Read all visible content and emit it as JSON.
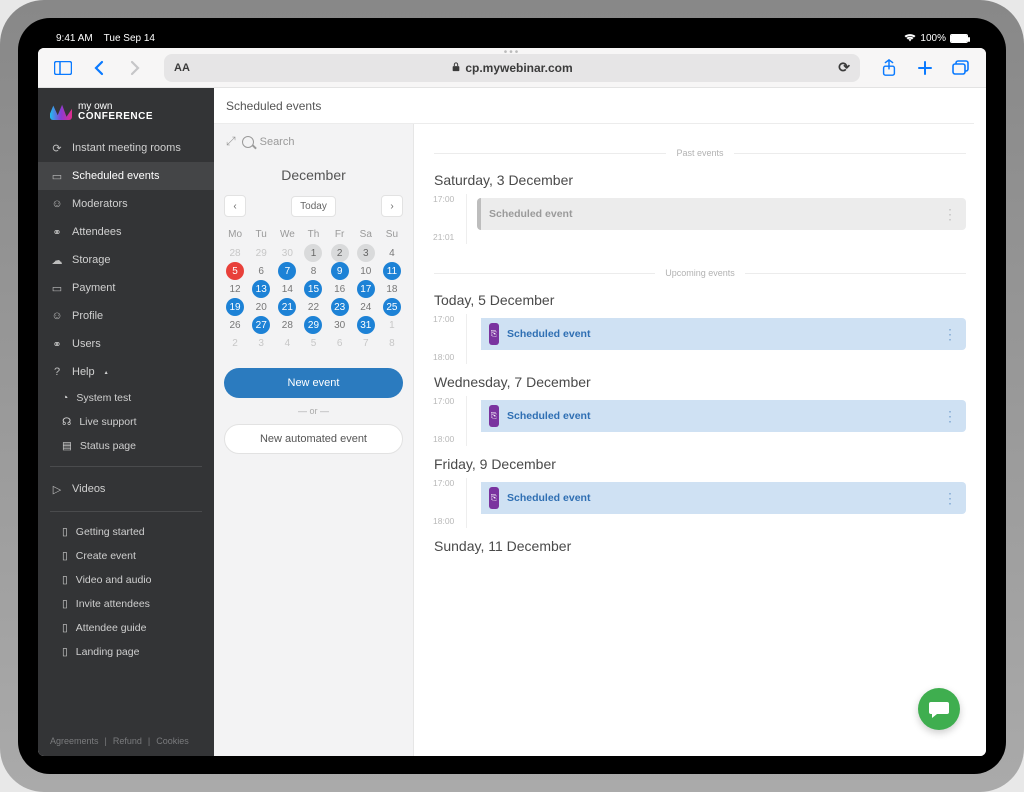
{
  "status": {
    "time": "9:41 AM",
    "date": "Tue Sep 14",
    "battery": "100%"
  },
  "browser": {
    "url": "cp.mywebinar.com",
    "aa": "AA"
  },
  "brand": {
    "line1": "my own",
    "line2": "CONFERENCE"
  },
  "nav": {
    "instant": "Instant meeting rooms",
    "scheduled": "Scheduled events",
    "moderators": "Moderators",
    "attendees": "Attendees",
    "storage": "Storage",
    "payment": "Payment",
    "profile": "Profile",
    "users": "Users",
    "help": "Help",
    "system_test": "System test",
    "live_support": "Live support",
    "status_page": "Status page",
    "videos": "Videos",
    "getting_started": "Getting started",
    "create_event": "Create event",
    "video_audio": "Video and audio",
    "invite_attendees": "Invite attendees",
    "attendee_guide": "Attendee guide",
    "landing_page": "Landing page"
  },
  "footer": {
    "agreements": "Agreements",
    "refund": "Refund",
    "cookies": "Cookies"
  },
  "page_title": "Scheduled events",
  "search_placeholder": "Search",
  "calendar": {
    "month": "December",
    "today_btn": "Today",
    "dow": [
      "Mo",
      "Tu",
      "We",
      "Th",
      "Fr",
      "Sa",
      "Su"
    ],
    "rows": [
      [
        {
          "n": "28",
          "cls": "dim"
        },
        {
          "n": "29",
          "cls": "dim"
        },
        {
          "n": "30",
          "cls": "dim"
        },
        {
          "n": "1",
          "cls": "gray-cell"
        },
        {
          "n": "2",
          "cls": "gray-cell"
        },
        {
          "n": "3",
          "cls": "gray-cell"
        },
        {
          "n": "4",
          "cls": ""
        }
      ],
      [
        {
          "n": "5",
          "cls": "today-cell"
        },
        {
          "n": "6",
          "cls": ""
        },
        {
          "n": "7",
          "cls": "has-event"
        },
        {
          "n": "8",
          "cls": ""
        },
        {
          "n": "9",
          "cls": "has-event"
        },
        {
          "n": "10",
          "cls": ""
        },
        {
          "n": "11",
          "cls": "has-event"
        }
      ],
      [
        {
          "n": "12",
          "cls": ""
        },
        {
          "n": "13",
          "cls": "has-event"
        },
        {
          "n": "14",
          "cls": ""
        },
        {
          "n": "15",
          "cls": "has-event"
        },
        {
          "n": "16",
          "cls": ""
        },
        {
          "n": "17",
          "cls": "has-event"
        },
        {
          "n": "18",
          "cls": ""
        }
      ],
      [
        {
          "n": "19",
          "cls": "has-event"
        },
        {
          "n": "20",
          "cls": ""
        },
        {
          "n": "21",
          "cls": "has-event"
        },
        {
          "n": "22",
          "cls": ""
        },
        {
          "n": "23",
          "cls": "has-event"
        },
        {
          "n": "24",
          "cls": ""
        },
        {
          "n": "25",
          "cls": "has-event"
        }
      ],
      [
        {
          "n": "26",
          "cls": ""
        },
        {
          "n": "27",
          "cls": "has-event"
        },
        {
          "n": "28",
          "cls": ""
        },
        {
          "n": "29",
          "cls": "has-event"
        },
        {
          "n": "30",
          "cls": ""
        },
        {
          "n": "31",
          "cls": "has-event"
        },
        {
          "n": "1",
          "cls": "dim"
        }
      ],
      [
        {
          "n": "2",
          "cls": "dim"
        },
        {
          "n": "3",
          "cls": "dim"
        },
        {
          "n": "4",
          "cls": "dim"
        },
        {
          "n": "5",
          "cls": "dim"
        },
        {
          "n": "6",
          "cls": "dim"
        },
        {
          "n": "7",
          "cls": "dim"
        },
        {
          "n": "8",
          "cls": "dim"
        }
      ]
    ]
  },
  "buttons": {
    "new_event": "New event",
    "or": "— or —",
    "new_auto": "New automated event"
  },
  "dividers": {
    "past": "Past events",
    "upcoming": "Upcoming events"
  },
  "days": [
    {
      "heading": "Saturday, 3 December",
      "t1": "17:00",
      "t2": "21:01",
      "event": "Scheduled event",
      "kind": "past"
    },
    {
      "heading": "Today, 5 December",
      "t1": "17:00",
      "t2": "18:00",
      "event": "Scheduled event",
      "kind": "upcoming"
    },
    {
      "heading": "Wednesday, 7 December",
      "t1": "17:00",
      "t2": "18:00",
      "event": "Scheduled event",
      "kind": "upcoming"
    },
    {
      "heading": "Friday, 9 December",
      "t1": "17:00",
      "t2": "18:00",
      "event": "Scheduled event",
      "kind": "upcoming"
    },
    {
      "heading": "Sunday, 11 December",
      "t1": "",
      "t2": "",
      "event": "",
      "kind": "cut"
    }
  ]
}
